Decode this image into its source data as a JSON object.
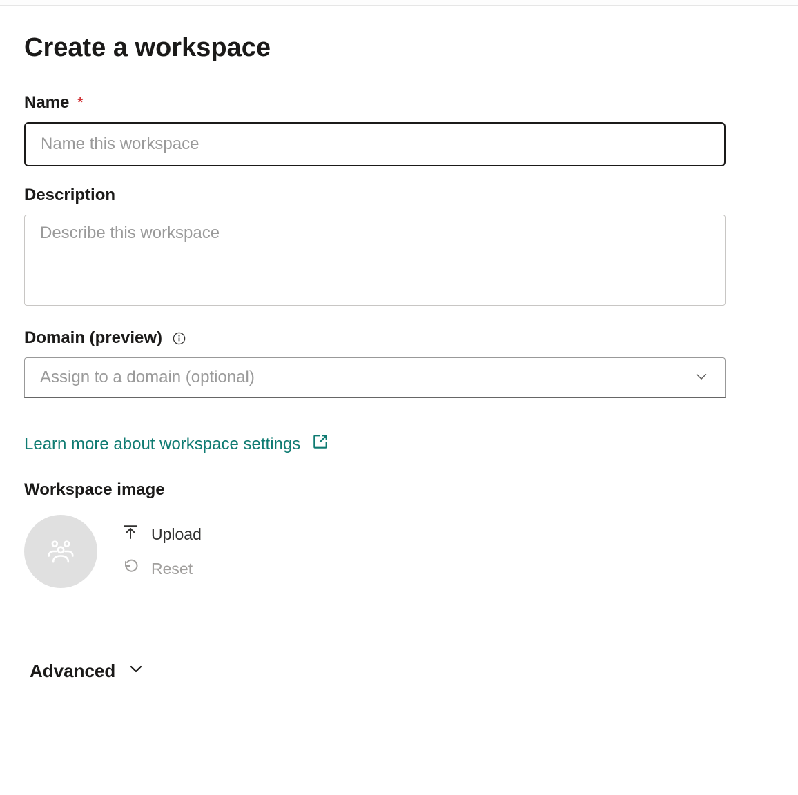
{
  "page": {
    "title": "Create a workspace"
  },
  "fields": {
    "name": {
      "label": "Name",
      "placeholder": "Name this workspace",
      "value": "",
      "required_marker": "*"
    },
    "description": {
      "label": "Description",
      "placeholder": "Describe this workspace",
      "value": ""
    },
    "domain": {
      "label": "Domain (preview)",
      "placeholder": "Assign to a domain (optional)",
      "value": ""
    }
  },
  "links": {
    "learn_more": "Learn more about workspace settings"
  },
  "image_section": {
    "title": "Workspace image",
    "upload_label": "Upload",
    "reset_label": "Reset"
  },
  "advanced": {
    "label": "Advanced"
  }
}
